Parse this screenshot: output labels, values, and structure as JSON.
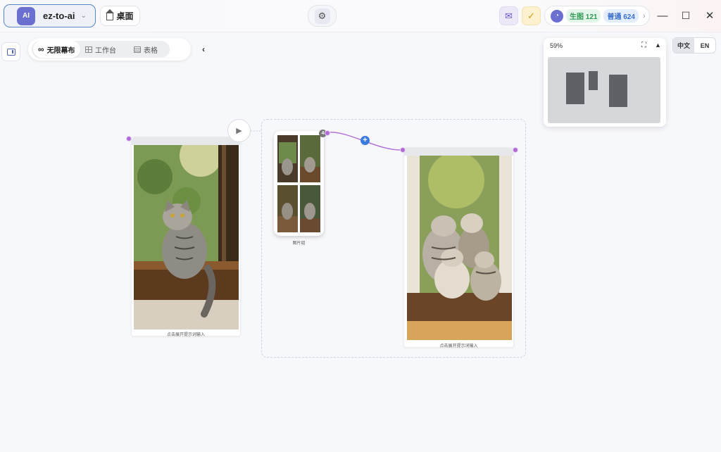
{
  "titlebar": {
    "workspace": {
      "avatar": "AI",
      "name": "ez-to-ai",
      "chevron": "chevron-down-icon"
    },
    "desktop_button": {
      "label": "桌面",
      "icon": "home-icon"
    },
    "settings_icon": "gear-icon",
    "mail_icon": "mail-icon",
    "check_icon": "check-icon",
    "credits": {
      "user_icon": "user-icon",
      "gen_label": "生图 121",
      "normal_label": "普通 624",
      "chevron": "chevron-right-icon"
    },
    "window_controls": {
      "minimize": "—",
      "maximize": "☐",
      "close": "✕"
    }
  },
  "view_bar": {
    "tabs": [
      {
        "label": "无限幕布",
        "icon": "infinity-icon",
        "active": true
      },
      {
        "label": "工作台",
        "icon": "grid-icon",
        "active": false
      },
      {
        "label": "表格",
        "icon": "table-icon",
        "active": false
      }
    ],
    "collapse": "‹"
  },
  "minimap": {
    "zoom": "59%",
    "fit_icon": "fullscreen-icon",
    "collapse_icon": "triangle-up-icon"
  },
  "language": {
    "options": [
      "中文",
      "EN"
    ],
    "active": "中文"
  },
  "canvas": {
    "nodes": [
      {
        "id": "input-image",
        "caption": "点击展开提示词输入"
      },
      {
        "id": "photo-stack",
        "caption": "图片组",
        "count": "4"
      },
      {
        "id": "output-image",
        "caption": "点击展开提示词输入"
      }
    ],
    "add_icon": "+",
    "run_icon": "play-icon"
  },
  "colors": {
    "accent": "#6a6fd0",
    "port": "#b06bd6",
    "link": "#3a7ae0",
    "workspace_border": "#5a86c8"
  }
}
